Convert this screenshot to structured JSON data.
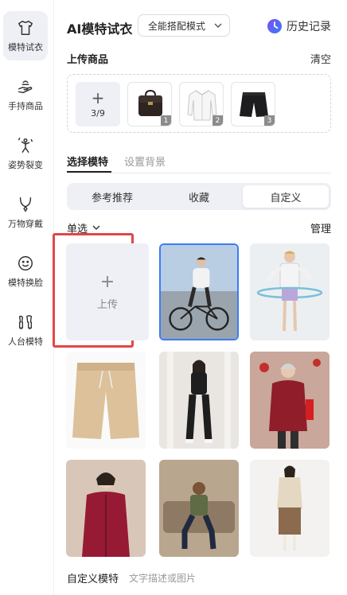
{
  "sidebar": {
    "items": [
      {
        "label": "模特试衣",
        "icon": "tshirt-icon",
        "active": true
      },
      {
        "label": "手持商品",
        "icon": "hand-holding-icon",
        "active": false
      },
      {
        "label": "姿势裂变",
        "icon": "pose-person-icon",
        "active": false
      },
      {
        "label": "万物穿戴",
        "icon": "necklace-icon",
        "active": false
      },
      {
        "label": "模特换脸",
        "icon": "face-swap-icon",
        "active": false
      },
      {
        "label": "人台模特",
        "icon": "mannequin-icon",
        "active": false
      }
    ]
  },
  "header": {
    "title": "AI模特试衣",
    "mode_select": "全能搭配模式",
    "history": "历史记录"
  },
  "upload": {
    "title": "上传商品",
    "clear": "清空",
    "add_plus": "+",
    "count": "3/9",
    "products": [
      {
        "badge": "1",
        "icon": "leather-bag"
      },
      {
        "badge": "2",
        "icon": "white-shirt"
      },
      {
        "badge": "3",
        "icon": "black-shorts"
      }
    ]
  },
  "tabs": {
    "model": "选择模特",
    "background": "设置背景"
  },
  "segment": {
    "items": [
      "参考推荐",
      "收藏",
      "自定义"
    ],
    "active_index": 2
  },
  "filter": {
    "select_mode": "单选",
    "manage": "管理"
  },
  "upload_card": {
    "plus": "+",
    "label": "上传"
  },
  "models": [
    {
      "name": "man-cycling",
      "selected": true
    },
    {
      "name": "man-hula-hoop",
      "selected": false
    },
    {
      "name": "khaki-shorts",
      "selected": false
    },
    {
      "name": "woman-black-outfit",
      "selected": false
    },
    {
      "name": "elderly-woman-red-coat",
      "selected": false
    },
    {
      "name": "woman-red-cardigan",
      "selected": false
    },
    {
      "name": "man-sitting-sofa",
      "selected": false
    },
    {
      "name": "woman-beige-cardigan",
      "selected": false
    }
  ],
  "custom_model": {
    "title": "自定义模特",
    "hint": "文字描述或图片"
  },
  "colors": {
    "accent": "#3b7cf7",
    "highlight_frame": "#e04848",
    "segment_bg": "#eef0f5"
  }
}
